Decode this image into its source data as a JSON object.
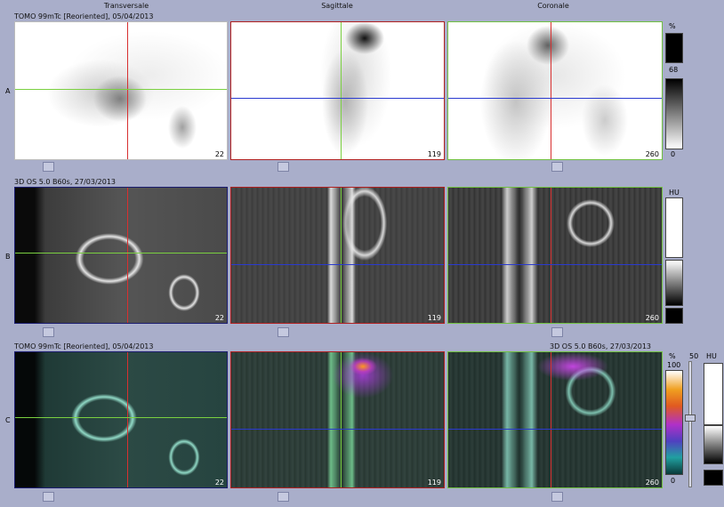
{
  "headers": {
    "transversale": "Transversale",
    "sagittale": "Sagittale",
    "coronale": "Coronale"
  },
  "rows": {
    "a": {
      "label": "A",
      "title": "TOMO 99mTc [Reoriented], 05/04/2013"
    },
    "b": {
      "label": "B",
      "title": "3D  OS  5.0  B60s, 27/03/2013"
    },
    "c": {
      "label": "C",
      "title_left": "TOMO 99mTc [Reoriented], 05/04/2013",
      "title_right": "3D  OS  5.0  B60s, 27/03/2013"
    }
  },
  "slices": {
    "transversale": "22",
    "sagittale": "119",
    "coronale": "260"
  },
  "scales": {
    "a": {
      "unit": "%",
      "mid": "68",
      "min": "0"
    },
    "b": {
      "unit": "HU"
    },
    "c": {
      "unit_pct": "%",
      "max": "100",
      "min": "0",
      "unit_hu": "HU",
      "value": "50"
    }
  },
  "colors": {
    "crosshair_red": "#d83030",
    "crosshair_green": "#7ad040",
    "crosshair_blue": "#2a3ad0",
    "frame_trans": "#1a1c6e",
    "frame_sag": "#b02020",
    "frame_cor": "#70c040"
  }
}
